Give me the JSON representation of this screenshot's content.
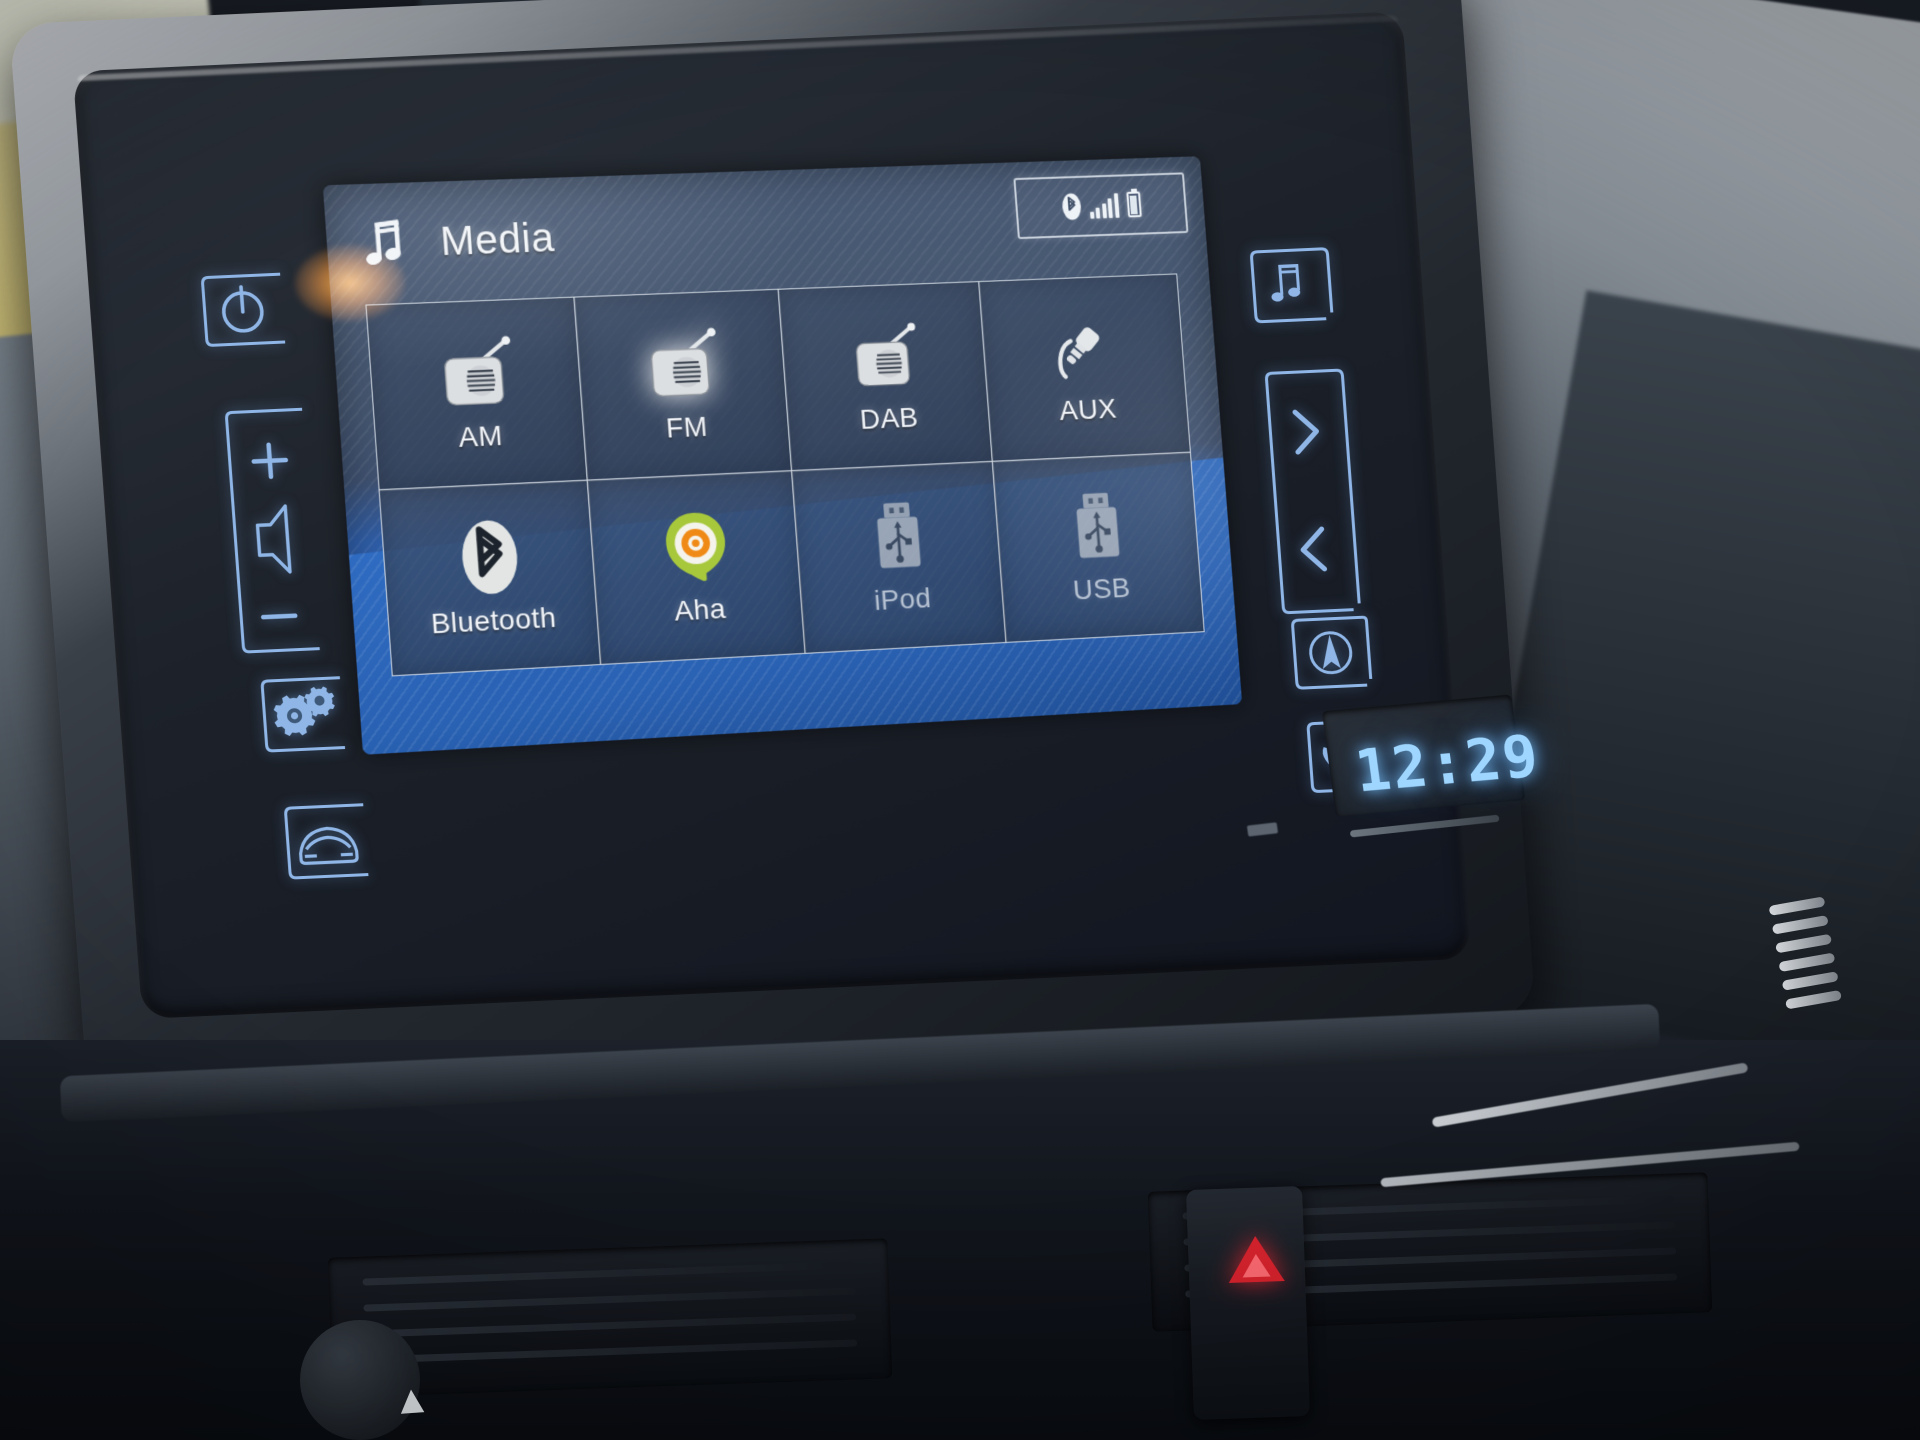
{
  "screen": {
    "header": {
      "icon": "music-note-icon",
      "title": "Media"
    },
    "status_bar": {
      "bluetooth_icon": "bluetooth-icon",
      "signal_icon": "signal-strength-icon",
      "signal_bars": 5,
      "signal_bars_filled": 5,
      "battery_icon": "battery-icon",
      "battery_level": "full"
    },
    "tiles": [
      {
        "label": "AM",
        "icon": "radio-icon",
        "state": "enabled",
        "name": "tile-am"
      },
      {
        "label": "FM",
        "icon": "radio-icon",
        "state": "selected",
        "name": "tile-fm"
      },
      {
        "label": "DAB",
        "icon": "radio-icon",
        "state": "enabled",
        "name": "tile-dab"
      },
      {
        "label": "AUX",
        "icon": "aux-jack-icon",
        "state": "enabled",
        "name": "tile-aux"
      },
      {
        "label": "Bluetooth",
        "icon": "bluetooth-icon",
        "state": "enabled",
        "name": "tile-bluetooth"
      },
      {
        "label": "Aha",
        "icon": "aha-pin-icon",
        "state": "enabled",
        "name": "tile-aha"
      },
      {
        "label": "iPod",
        "icon": "usb-icon",
        "state": "disabled",
        "name": "tile-ipod"
      },
      {
        "label": "USB",
        "icon": "usb-icon",
        "state": "disabled",
        "name": "tile-usb"
      }
    ]
  },
  "hard_buttons": {
    "left": [
      {
        "name": "power-button",
        "icon": "power-icon",
        "label": ""
      },
      {
        "name": "volume-up-button",
        "icon": "plus-icon",
        "label": ""
      },
      {
        "name": "volume-speaker",
        "icon": "speaker-icon",
        "label": ""
      },
      {
        "name": "volume-down-button",
        "icon": "minus-icon",
        "label": ""
      },
      {
        "name": "setup-button",
        "icon": "gears-icon",
        "label": ""
      },
      {
        "name": "vehicle-button",
        "icon": "car-icon",
        "label": ""
      }
    ],
    "right": [
      {
        "name": "media-button",
        "icon": "music-note-icon",
        "label": ""
      },
      {
        "name": "seek-next-button",
        "icon": "chevron-right-icon",
        "label": ""
      },
      {
        "name": "seek-prev-button",
        "icon": "chevron-left-icon",
        "label": ""
      },
      {
        "name": "navigation-button",
        "icon": "compass-icon",
        "label": ""
      },
      {
        "name": "phone-button",
        "icon": "phone-icon",
        "label": ""
      }
    ]
  },
  "clock": {
    "time": "12:29"
  },
  "colors": {
    "screen_bg": "#45566f",
    "screen_accent": "#2c66bb",
    "tile_border": "#e8eff7",
    "backlight_blue": "#8fb6e6",
    "clock_blue": "#9fd6ff",
    "power_led": "#f58c1e",
    "aha_green": "#a8c83c",
    "aha_orange": "#f08a16",
    "hazard_red": "#d9232e"
  }
}
